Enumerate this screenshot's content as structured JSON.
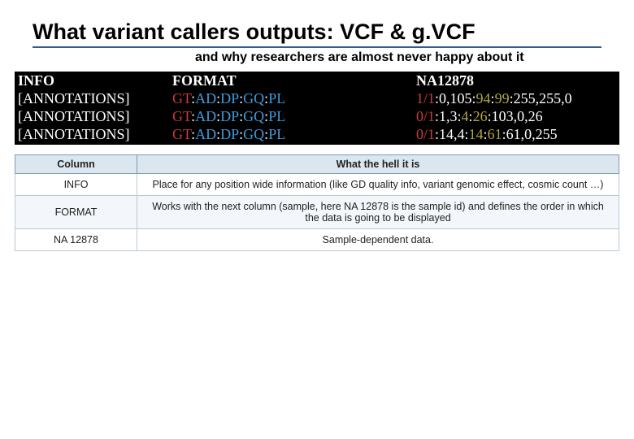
{
  "title": "What variant callers outputs: VCF & g.VCF",
  "subtitle": "and why researchers are almost never happy about it",
  "vcf": {
    "headers": {
      "info": "INFO",
      "format": "FORMAT",
      "sample": "NA12878"
    },
    "rows": [
      {
        "info": "[ANNOTATIONS]",
        "format": [
          {
            "t": "GT",
            "c": "gt"
          },
          {
            "t": ":",
            "c": "sep"
          },
          {
            "t": "AD",
            "c": "fld"
          },
          {
            "t": ":",
            "c": "sep"
          },
          {
            "t": "DP",
            "c": "fld"
          },
          {
            "t": ":",
            "c": "sep"
          },
          {
            "t": "GQ",
            "c": "fld"
          },
          {
            "t": ":",
            "c": "sep"
          },
          {
            "t": "PL",
            "c": "fld"
          }
        ],
        "sample": [
          {
            "t": "1/1",
            "c": "gt"
          },
          {
            "t": ":",
            "c": "sep"
          },
          {
            "t": "0,105",
            "c": "val"
          },
          {
            "t": ":",
            "c": "sep"
          },
          {
            "t": "94",
            "c": "olv"
          },
          {
            "t": ":",
            "c": "sep"
          },
          {
            "t": "99",
            "c": "olv"
          },
          {
            "t": ":",
            "c": "sep"
          },
          {
            "t": "255,255,0",
            "c": "val"
          }
        ]
      },
      {
        "info": "[ANNOTATIONS]",
        "format": [
          {
            "t": "GT",
            "c": "gt"
          },
          {
            "t": ":",
            "c": "sep"
          },
          {
            "t": "AD",
            "c": "fld"
          },
          {
            "t": ":",
            "c": "sep"
          },
          {
            "t": "DP",
            "c": "fld"
          },
          {
            "t": ":",
            "c": "sep"
          },
          {
            "t": "GQ",
            "c": "fld"
          },
          {
            "t": ":",
            "c": "sep"
          },
          {
            "t": "PL",
            "c": "fld"
          }
        ],
        "sample": [
          {
            "t": "0/1",
            "c": "gt"
          },
          {
            "t": ":",
            "c": "sep"
          },
          {
            "t": "1,3",
            "c": "val"
          },
          {
            "t": ":",
            "c": "sep"
          },
          {
            "t": "4",
            "c": "olv"
          },
          {
            "t": ":",
            "c": "sep"
          },
          {
            "t": "26",
            "c": "olv"
          },
          {
            "t": ":",
            "c": "sep"
          },
          {
            "t": "103,0,26",
            "c": "val"
          }
        ]
      },
      {
        "info": "[ANNOTATIONS]",
        "format": [
          {
            "t": "GT",
            "c": "gt"
          },
          {
            "t": ":",
            "c": "sep"
          },
          {
            "t": "AD",
            "c": "fld"
          },
          {
            "t": ":",
            "c": "sep"
          },
          {
            "t": "DP",
            "c": "fld"
          },
          {
            "t": ":",
            "c": "sep"
          },
          {
            "t": "GQ",
            "c": "fld"
          },
          {
            "t": ":",
            "c": "sep"
          },
          {
            "t": "PL",
            "c": "fld"
          }
        ],
        "sample": [
          {
            "t": "0/1",
            "c": "gt"
          },
          {
            "t": ":",
            "c": "sep"
          },
          {
            "t": "14,4",
            "c": "val"
          },
          {
            "t": ":",
            "c": "sep"
          },
          {
            "t": "14",
            "c": "olv"
          },
          {
            "t": ":",
            "c": "sep"
          },
          {
            "t": "61",
            "c": "olv"
          },
          {
            "t": ":",
            "c": "sep"
          },
          {
            "t": "61,0,255",
            "c": "val"
          }
        ]
      }
    ]
  },
  "explain": {
    "headers": {
      "col": "Column",
      "desc": "What the hell it is"
    },
    "rows": [
      {
        "col": "INFO",
        "desc": "Place for any position wide information (like GD quality info,  variant genomic effect, cosmic count …)"
      },
      {
        "col": "FORMAT",
        "desc": "Works with the next column (sample, here NA 12878 is the  sample id) and defines the order in which the data is going to be  displayed"
      },
      {
        "col": "NA 12878",
        "desc": "Sample-dependent data."
      }
    ]
  }
}
